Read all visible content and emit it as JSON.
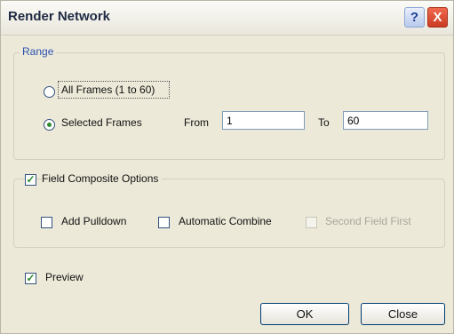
{
  "window": {
    "title": "Render Network"
  },
  "titlebar": {
    "help_label": "?",
    "close_label": "X"
  },
  "range": {
    "legend": "Range",
    "all_frames_label": "All Frames (1 to 60)",
    "selected_frames_label": "Selected Frames",
    "from_label": "From",
    "from_value": "1",
    "to_label": "To",
    "to_value": "60",
    "selected_option": "selected_frames"
  },
  "field_composite": {
    "label": "Field Composite Options",
    "checked": true,
    "add_pulldown_label": "Add Pulldown",
    "add_pulldown_checked": false,
    "automatic_combine_label": "Automatic Combine",
    "automatic_combine_checked": false,
    "second_field_first_label": "Second Field First",
    "second_field_first_enabled": false
  },
  "preview": {
    "label": "Preview",
    "checked": true
  },
  "buttons": {
    "ok_label": "OK",
    "close_label": "Close"
  },
  "colors": {
    "accent_check": "#2b8a2b",
    "title_text": "#1f2a44",
    "close_button": "#c93a22"
  }
}
